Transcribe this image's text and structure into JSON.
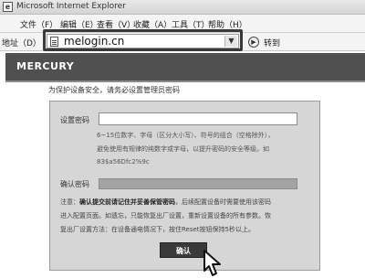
{
  "window": {
    "title": "Microsoft Internet Explorer"
  },
  "menu": {
    "items": [
      "文件（F）",
      "编辑（E）",
      "查看（V）",
      "收藏（A）",
      "工具（T）",
      "帮助（H）"
    ]
  },
  "address_bar": {
    "label": "地址（D）",
    "url": "melogin.cn",
    "go_label": "转到"
  },
  "brand": {
    "logo": "MERCURY"
  },
  "page": {
    "security_note": "为保护设备安全，请务必设置管理员密码",
    "password_label": "设置密码",
    "password_value": "",
    "hint_lines": [
      "6~15位数字、字母（区分大小写）、符号的组合（空格除外），",
      "避免使用有规律的纯数字或字母，以提升密码的安全等级。如",
      "83$a56Dfc2%9c"
    ],
    "confirm_label": "确认密码",
    "confirm_value": "",
    "note_prefix": "注意：",
    "note_bold": "确认提交前请记住并妥善保管密码",
    "note_line1_rest": "，后续配置设备时需要使用该密码",
    "note_line2": "进入配置页面。如遗忘，只能恢复出厂设置，重新设置设备的所有参数。恢",
    "note_line3": "复出厂设置方法：在设备通电情况下，按住Reset按钮保持5秒以上。",
    "confirm_button": "确认"
  }
}
